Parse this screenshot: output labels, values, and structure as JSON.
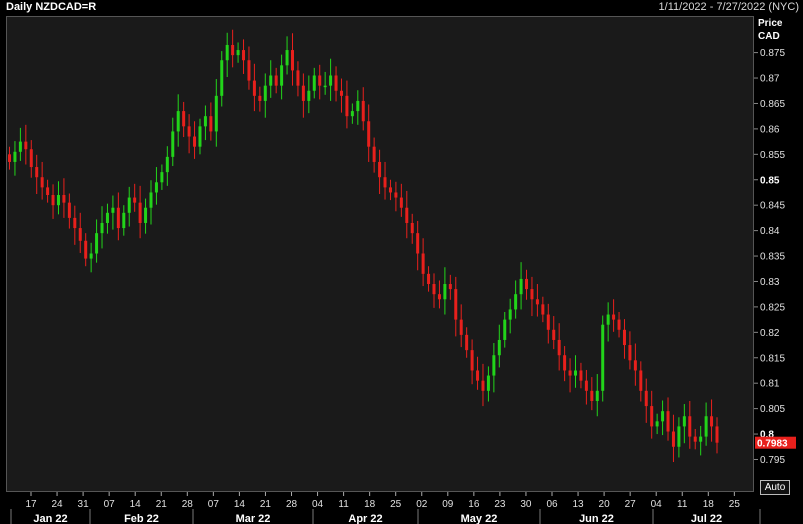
{
  "header": {
    "title": "Daily NZDCAD=R",
    "date_range": "1/11/2022 - 7/27/2022 (NYC)"
  },
  "axis": {
    "price_label_line1": "Price",
    "price_label_line2": "CAD",
    "auto_button": "Auto"
  },
  "colors": {
    "up": "#22d41a",
    "down": "#e8201c",
    "background": "#1a1a1a",
    "last_price_bg": "#e8201c"
  },
  "chart_data": {
    "type": "candlestick",
    "title": "Daily NZDCAD=R",
    "ylabel": "Price CAD",
    "ylim": [
      0.789,
      0.882
    ],
    "y_ticks": [
      "0.875",
      "0.87",
      "0.865",
      "0.86",
      "0.855",
      "0.85",
      "0.845",
      "0.84",
      "0.835",
      "0.83",
      "0.825",
      "0.82",
      "0.815",
      "0.81",
      "0.805",
      "0.8",
      "0.795"
    ],
    "y_ticks_bold": [
      "0.85",
      "0.8"
    ],
    "x_ticks": [
      "17",
      "24",
      "31",
      "07",
      "14",
      "21",
      "28",
      "07",
      "14",
      "21",
      "28",
      "04",
      "11",
      "18",
      "25",
      "02",
      "09",
      "16",
      "23",
      "30",
      "06",
      "13",
      "20",
      "27",
      "04",
      "11",
      "18",
      "25"
    ],
    "months": [
      "Jan 22",
      "Feb 22",
      "Mar 22",
      "Apr 22",
      "May 22",
      "Jun 22",
      "Jul 22"
    ],
    "last_price": "0.7983",
    "closes": [
      0.8535,
      0.8555,
      0.8575,
      0.856,
      0.8525,
      0.8505,
      0.8485,
      0.847,
      0.845,
      0.847,
      0.8455,
      0.8425,
      0.8405,
      0.838,
      0.8345,
      0.8355,
      0.8395,
      0.8415,
      0.8435,
      0.8445,
      0.8405,
      0.8435,
      0.8465,
      0.8455,
      0.8415,
      0.8445,
      0.8475,
      0.8495,
      0.8515,
      0.8545,
      0.8595,
      0.8635,
      0.8605,
      0.8585,
      0.8565,
      0.8605,
      0.8625,
      0.8595,
      0.8665,
      0.8735,
      0.8765,
      0.8745,
      0.8755,
      0.8735,
      0.8695,
      0.8665,
      0.8655,
      0.8685,
      0.8705,
      0.8685,
      0.8725,
      0.8755,
      0.8715,
      0.8685,
      0.8655,
      0.8675,
      0.8705,
      0.8685,
      0.8685,
      0.8705,
      0.8675,
      0.8665,
      0.8625,
      0.8635,
      0.8655,
      0.8615,
      0.8565,
      0.8535,
      0.8505,
      0.8485,
      0.8475,
      0.8465,
      0.8445,
      0.8415,
      0.8395,
      0.8355,
      0.8315,
      0.8295,
      0.8275,
      0.8265,
      0.8295,
      0.8285,
      0.8225,
      0.8195,
      0.8165,
      0.8125,
      0.8105,
      0.8085,
      0.8115,
      0.8155,
      0.8185,
      0.8225,
      0.8245,
      0.8275,
      0.8305,
      0.8285,
      0.8265,
      0.8255,
      0.8235,
      0.8205,
      0.8185,
      0.8155,
      0.8125,
      0.8115,
      0.8125,
      0.8105,
      0.8085,
      0.8065,
      0.8085,
      0.8215,
      0.8235,
      0.8225,
      0.8205,
      0.8175,
      0.8145,
      0.8125,
      0.8085,
      0.8055,
      0.8015,
      0.8025,
      0.8045,
      0.8005,
      0.7975,
      0.8015,
      0.8035,
      0.7995,
      0.7985,
      0.7995,
      0.8035,
      0.8015,
      0.7983
    ]
  }
}
